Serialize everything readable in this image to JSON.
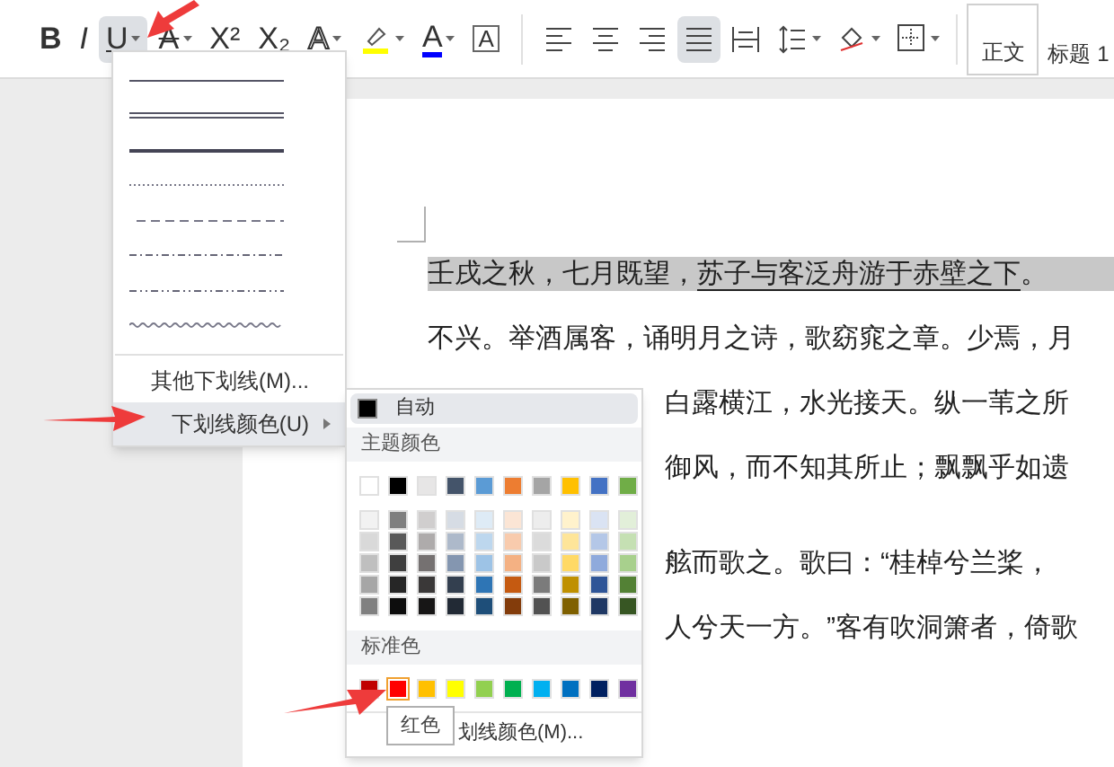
{
  "toolbar": {
    "font_tools": [
      {
        "kind": "bold",
        "glyph": "B",
        "active": false,
        "dropdown": false
      },
      {
        "kind": "italic",
        "glyph": "I",
        "active": false,
        "dropdown": false
      },
      {
        "kind": "underline",
        "glyph": "U",
        "active": true,
        "dropdown": true
      },
      {
        "kind": "strike",
        "glyph": "A",
        "active": false,
        "dropdown": true
      },
      {
        "kind": "plain",
        "glyph": "X²",
        "active": false,
        "dropdown": false
      },
      {
        "kind": "plain",
        "glyph": "X₂",
        "active": false,
        "dropdown": false
      },
      {
        "kind": "outline",
        "glyph": "A",
        "active": false,
        "dropdown": true
      },
      {
        "kind": "highlighter",
        "active": false,
        "dropdown": true
      },
      {
        "kind": "font_color",
        "glyph": "A",
        "active": false,
        "dropdown": true
      },
      {
        "kind": "boxed",
        "glyph": "A",
        "active": false,
        "dropdown": false
      }
    ],
    "paragraph_tools": [
      {
        "kind": "align_left",
        "active": false,
        "dropdown": false
      },
      {
        "kind": "align_center",
        "active": false,
        "dropdown": false
      },
      {
        "kind": "align_right",
        "active": false,
        "dropdown": false
      },
      {
        "kind": "justify",
        "active": true,
        "dropdown": false
      },
      {
        "kind": "distribute",
        "active": false,
        "dropdown": false
      },
      {
        "kind": "line_spacing",
        "active": false,
        "dropdown": true
      },
      {
        "kind": "shading",
        "active": false,
        "dropdown": true
      },
      {
        "kind": "borders",
        "active": false,
        "dropdown": true
      }
    ],
    "styles": [
      {
        "label": "正文",
        "selected": true
      },
      {
        "label": "标题 1",
        "selected": false
      }
    ]
  },
  "document": {
    "paragraphs": [
      {
        "lines": [
          {
            "kind": "full",
            "highlighted": true,
            "segments": [
              {
                "text": "壬戌之秋，七月既望，",
                "underline": false
              },
              {
                "text": "苏子与客泛舟游于赤壁之下",
                "underline": true
              },
              {
                "text": "。",
                "underline": false
              }
            ]
          },
          {
            "kind": "full",
            "highlighted": false,
            "segments": [
              {
                "text": "不兴。举酒属客，诵明月之诗，歌窈窕之章。少焉，月",
                "underline": false
              }
            ]
          },
          {
            "kind": "partial",
            "highlighted": false,
            "segments": [
              {
                "text": "白露横江，水光接天。纵一苇之所",
                "underline": false
              }
            ]
          },
          {
            "kind": "partial",
            "highlighted": false,
            "segments": [
              {
                "text": "御风，而不知其所止；飘飘乎如遗",
                "underline": false
              }
            ]
          }
        ]
      },
      {
        "lines": [
          {
            "kind": "partial",
            "highlighted": false,
            "segments": [
              {
                "text": "舷而歌之。歌曰：“桂棹兮兰桨，",
                "underline": false
              }
            ]
          },
          {
            "kind": "partial",
            "highlighted": false,
            "segments": [
              {
                "text": "人兮天一方。”客有吹洞箫者，倚歌",
                "underline": false
              }
            ]
          }
        ]
      }
    ]
  },
  "underline_menu": {
    "line_styles": [
      {
        "kind": "single"
      },
      {
        "kind": "double"
      },
      {
        "kind": "thick"
      },
      {
        "kind": "dotted"
      },
      {
        "kind": "dashed"
      },
      {
        "kind": "dash_dot"
      },
      {
        "kind": "dash_dot_dot"
      },
      {
        "kind": "wave"
      }
    ],
    "items": [
      {
        "label": "其他下划线(M)...",
        "selected": false,
        "submenu": false
      },
      {
        "label": "下划线颜色(U)",
        "selected": true,
        "submenu": true
      }
    ]
  },
  "color_menu": {
    "auto": {
      "label": "自动",
      "selected": true
    },
    "theme_header": "主题颜色",
    "theme_row": [
      {
        "color": "#ffffff",
        "selected": false
      },
      {
        "color": "#000000",
        "selected": false
      },
      {
        "color": "#e7e6e6",
        "selected": false
      },
      {
        "color": "#44546a",
        "selected": false
      },
      {
        "color": "#5b9bd5",
        "selected": false
      },
      {
        "color": "#ed7d31",
        "selected": false
      },
      {
        "color": "#a5a5a5",
        "selected": false
      },
      {
        "color": "#ffc000",
        "selected": false
      },
      {
        "color": "#4472c4",
        "selected": false
      },
      {
        "color": "#70ad47",
        "selected": false
      }
    ],
    "shade_rows": [
      [
        {
          "color": "#f2f2f2",
          "selected": false
        },
        {
          "color": "#7f7f7f",
          "selected": false
        },
        {
          "color": "#d0cece",
          "selected": false
        },
        {
          "color": "#d6dce4",
          "selected": false
        },
        {
          "color": "#deebf6",
          "selected": false
        },
        {
          "color": "#fbe5d5",
          "selected": false
        },
        {
          "color": "#ededed",
          "selected": false
        },
        {
          "color": "#fff2cc",
          "selected": false
        },
        {
          "color": "#dae3f3",
          "selected": false
        },
        {
          "color": "#e2efd9",
          "selected": false
        }
      ],
      [
        {
          "color": "#d9d9d9",
          "selected": false
        },
        {
          "color": "#595959",
          "selected": false
        },
        {
          "color": "#aeabab",
          "selected": false
        },
        {
          "color": "#adb9ca",
          "selected": false
        },
        {
          "color": "#bdd7ee",
          "selected": false
        },
        {
          "color": "#f8cbad",
          "selected": false
        },
        {
          "color": "#dbdbdb",
          "selected": false
        },
        {
          "color": "#fee599",
          "selected": false
        },
        {
          "color": "#b4c7e7",
          "selected": false
        },
        {
          "color": "#c5e0b3",
          "selected": false
        }
      ],
      [
        {
          "color": "#bfbfbf",
          "selected": false
        },
        {
          "color": "#3f3f3f",
          "selected": false
        },
        {
          "color": "#757171",
          "selected": false
        },
        {
          "color": "#8496b0",
          "selected": false
        },
        {
          "color": "#9dc3e6",
          "selected": false
        },
        {
          "color": "#f4b183",
          "selected": false
        },
        {
          "color": "#c9c9c9",
          "selected": false
        },
        {
          "color": "#ffd966",
          "selected": false
        },
        {
          "color": "#8faadc",
          "selected": false
        },
        {
          "color": "#a8d08d",
          "selected": false
        }
      ],
      [
        {
          "color": "#a6a6a6",
          "selected": false
        },
        {
          "color": "#262626",
          "selected": false
        },
        {
          "color": "#3a3838",
          "selected": false
        },
        {
          "color": "#333f4f",
          "selected": false
        },
        {
          "color": "#2e75b5",
          "selected": false
        },
        {
          "color": "#c55a11",
          "selected": false
        },
        {
          "color": "#7b7b7b",
          "selected": false
        },
        {
          "color": "#bf9000",
          "selected": false
        },
        {
          "color": "#2f5597",
          "selected": false
        },
        {
          "color": "#538135",
          "selected": false
        }
      ],
      [
        {
          "color": "#808080",
          "selected": false
        },
        {
          "color": "#0d0d0d",
          "selected": false
        },
        {
          "color": "#171616",
          "selected": false
        },
        {
          "color": "#222a35",
          "selected": false
        },
        {
          "color": "#1e4e79",
          "selected": false
        },
        {
          "color": "#833c0b",
          "selected": false
        },
        {
          "color": "#525252",
          "selected": false
        },
        {
          "color": "#7f6000",
          "selected": false
        },
        {
          "color": "#1f3864",
          "selected": false
        },
        {
          "color": "#375623",
          "selected": false
        }
      ]
    ],
    "standard_header": "标准色",
    "standard_row": [
      {
        "color": "#c00000",
        "selected": false
      },
      {
        "color": "#ff0000",
        "selected": true
      },
      {
        "color": "#ffc000",
        "selected": false
      },
      {
        "color": "#ffff00",
        "selected": false
      },
      {
        "color": "#92d050",
        "selected": false
      },
      {
        "color": "#00b050",
        "selected": false
      },
      {
        "color": "#00b0f0",
        "selected": false
      },
      {
        "color": "#0070c0",
        "selected": false
      },
      {
        "color": "#002060",
        "selected": false
      },
      {
        "color": "#7030a0",
        "selected": false
      }
    ],
    "more_item": "划线颜色(M)...",
    "tooltip": "红色"
  }
}
